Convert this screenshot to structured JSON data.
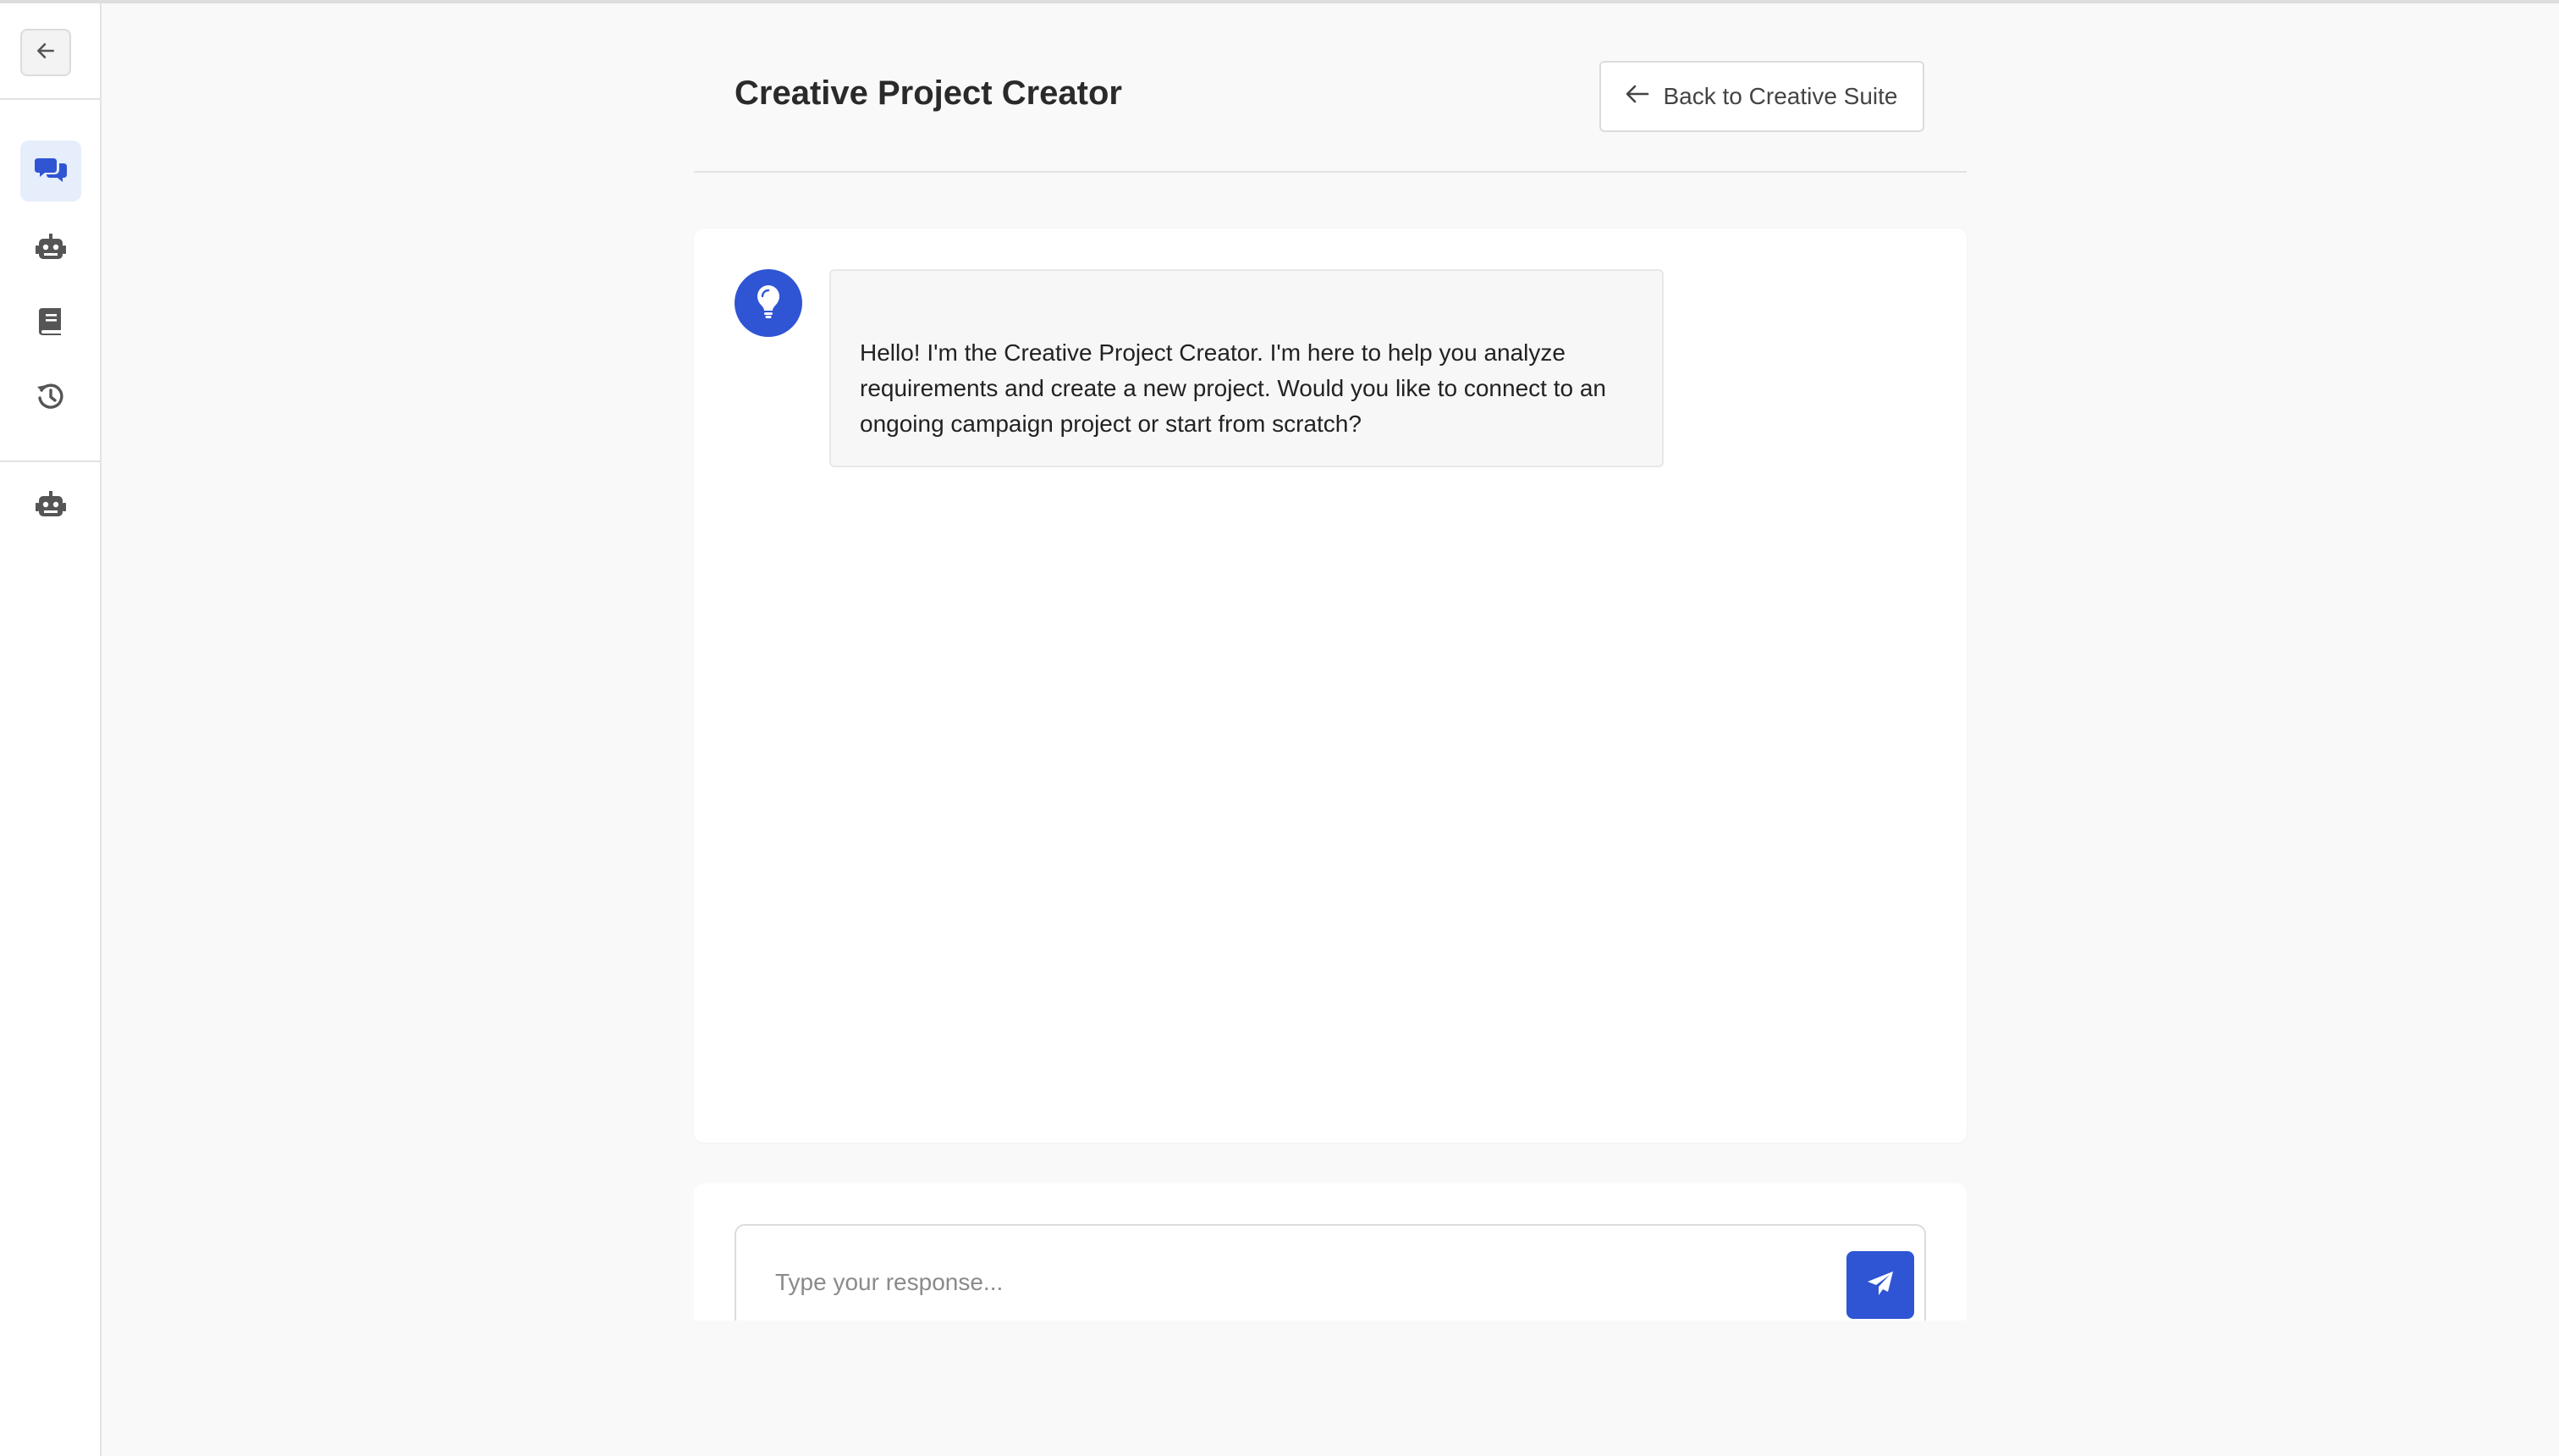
{
  "colors": {
    "accent": "#2f55d4",
    "active_nav_bg": "#e6edfb",
    "page_bg": "#f9f9f9"
  },
  "sidebar": {
    "collapse_icon": "arrow-left-icon",
    "items": [
      {
        "icon": "chat-bubbles-icon",
        "active": true
      },
      {
        "icon": "robot-icon",
        "active": false
      },
      {
        "icon": "book-icon",
        "active": false
      },
      {
        "icon": "history-icon",
        "active": false
      },
      {
        "icon": "robot-icon",
        "active": false
      }
    ]
  },
  "header": {
    "title": "Creative Project Creator",
    "back_button_label": "Back to Creative Suite",
    "back_button_icon": "arrow-left-icon"
  },
  "chat": {
    "messages": [
      {
        "role": "assistant",
        "avatar_icon": "lightbulb-icon",
        "text": "Hello! I'm the Creative Project Creator. I'm here to help you analyze requirements and create a new project. Would you like to connect to an ongoing campaign project or start from scratch?"
      }
    ]
  },
  "composer": {
    "placeholder": "Type your response...",
    "value": "",
    "send_icon": "paper-plane-icon"
  }
}
